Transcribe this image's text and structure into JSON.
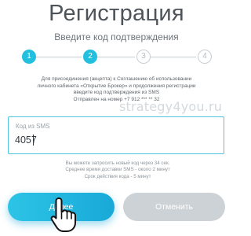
{
  "header": {
    "title": "Регистрация",
    "subtitle": "Введите код подтверждения"
  },
  "steps": [
    {
      "label": "1",
      "state": "active"
    },
    {
      "label": "2",
      "state": "active"
    },
    {
      "label": "3",
      "state": "inactive"
    },
    {
      "label": "4",
      "state": "inactive"
    }
  ],
  "info": {
    "line1": "Для присоединения (акцепта) к Соглашению об использовании",
    "line2": "личного кабинета «Открытие Брокер» и продолжения регистрации",
    "line3": "введите код подтверждения из SMS",
    "line4": "Отправлен на номер +7 912 *** ** 32"
  },
  "code_field": {
    "label": "Код из SMS",
    "value": "4057"
  },
  "watermark": "strategy4you.ru",
  "note": {
    "line1": "Вы можете запросить новый код через 34 сек.",
    "line2": "Среднее время доставки SMS - около 2 минут",
    "line3": "Срок действия кода - 5 минут"
  },
  "buttons": {
    "next_label": "Далее",
    "cancel_label": "Отменить"
  },
  "icons": {
    "cursor": "hand-pointer-icon"
  },
  "colors": {
    "accent": "#22bfdf",
    "inactive_button": "#cdd2d6",
    "field_border": "#4fc3e2"
  }
}
